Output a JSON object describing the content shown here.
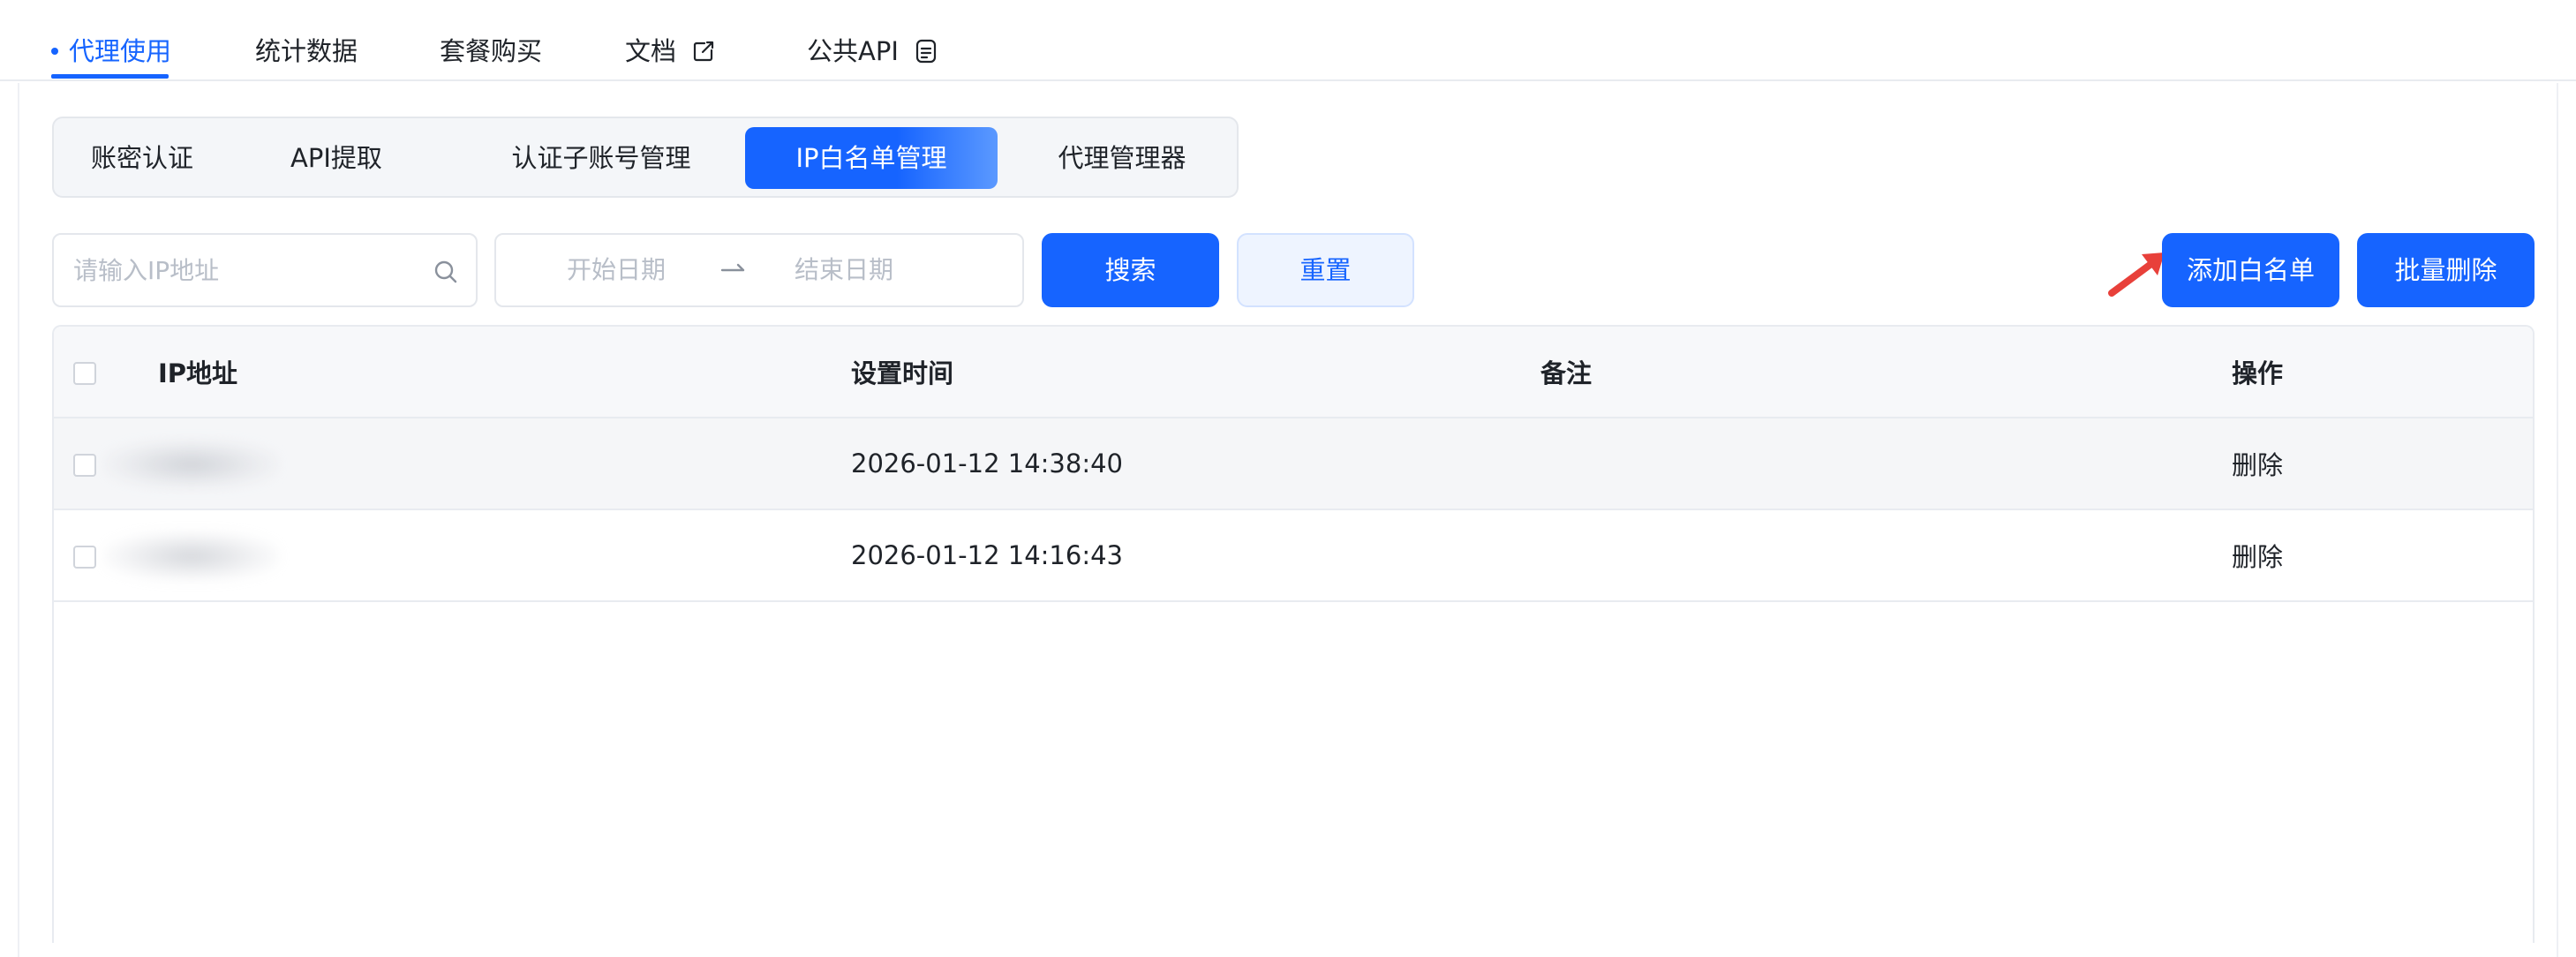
{
  "top_nav": {
    "tabs": [
      {
        "label": "代理使用",
        "active": true
      },
      {
        "label": "统计数据"
      },
      {
        "label": "套餐购买"
      },
      {
        "label": "文档",
        "icon": "external-link-icon"
      },
      {
        "label": "公共API",
        "icon": "document-icon"
      }
    ]
  },
  "sub_tabs": [
    {
      "label": "账密认证"
    },
    {
      "label": "API提取"
    },
    {
      "label": "认证子账号管理"
    },
    {
      "label": "IP白名单管理",
      "active": true
    },
    {
      "label": "代理管理器"
    }
  ],
  "filters": {
    "ip_placeholder": "请输入IP地址",
    "start_date_placeholder": "开始日期",
    "end_date_placeholder": "结束日期",
    "search_label": "搜索",
    "reset_label": "重置"
  },
  "actions": {
    "add_whitelist_label": "添加白名单",
    "batch_delete_label": "批量删除"
  },
  "table": {
    "columns": {
      "ip": "IP地址",
      "time": "设置时间",
      "note": "备注",
      "action": "操作"
    },
    "rows": [
      {
        "time": "2026-01-12 14:38:40",
        "action": "删除"
      },
      {
        "time": "2026-01-12 14:16:43",
        "action": "删除"
      }
    ]
  },
  "colors": {
    "primary": "#1664ff",
    "annotation_arrow": "#e8403a"
  }
}
